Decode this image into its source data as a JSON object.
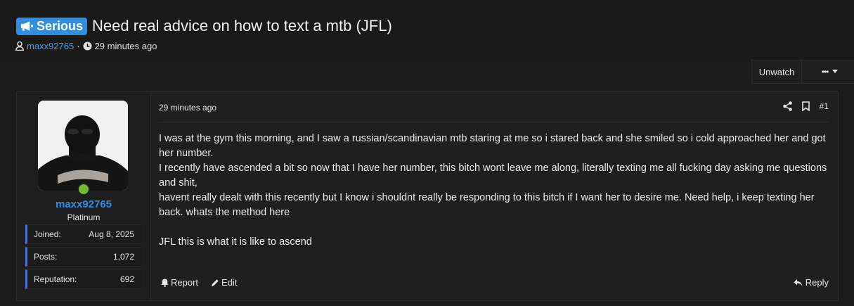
{
  "thread": {
    "prefix": "Serious",
    "title": "Need real advice on how to text a mtb (JFL)",
    "author": "maxx92765",
    "separator": "·",
    "time_ago": "29 minutes ago"
  },
  "actions": {
    "unwatch_label": "Unwatch",
    "more_label": "•••"
  },
  "user": {
    "username": "maxx92765",
    "title": "Platinum",
    "stats": [
      {
        "label": "Joined:",
        "value": "Aug 8, 2025"
      },
      {
        "label": "Posts:",
        "value": "1,072"
      },
      {
        "label": "Reputation:",
        "value": "692"
      }
    ]
  },
  "post": {
    "time": "29 minutes ago",
    "number": "#1",
    "lines": [
      "I was at the gym this morning, and I saw a russian/scandinavian mtb staring at me so i stared back and she smiled so i cold approached her and got her number.",
      "I recently have ascended a bit so now that I have her number, this bitch wont leave me along, literally texting me all fucking day asking me questions and shit,",
      "havent really dealt with this recently but I know i shouldnt really be responding to this bitch if I want her to desire me. Need help, i keep texting her back. whats the method here",
      "JFL this is what it is like to ascend"
    ],
    "report_label": "Report",
    "edit_label": "Edit",
    "reply_label": "Reply"
  },
  "colors": {
    "accent": "#2f8ee0",
    "background": "#1b1b1c",
    "online": "#74b92a"
  }
}
